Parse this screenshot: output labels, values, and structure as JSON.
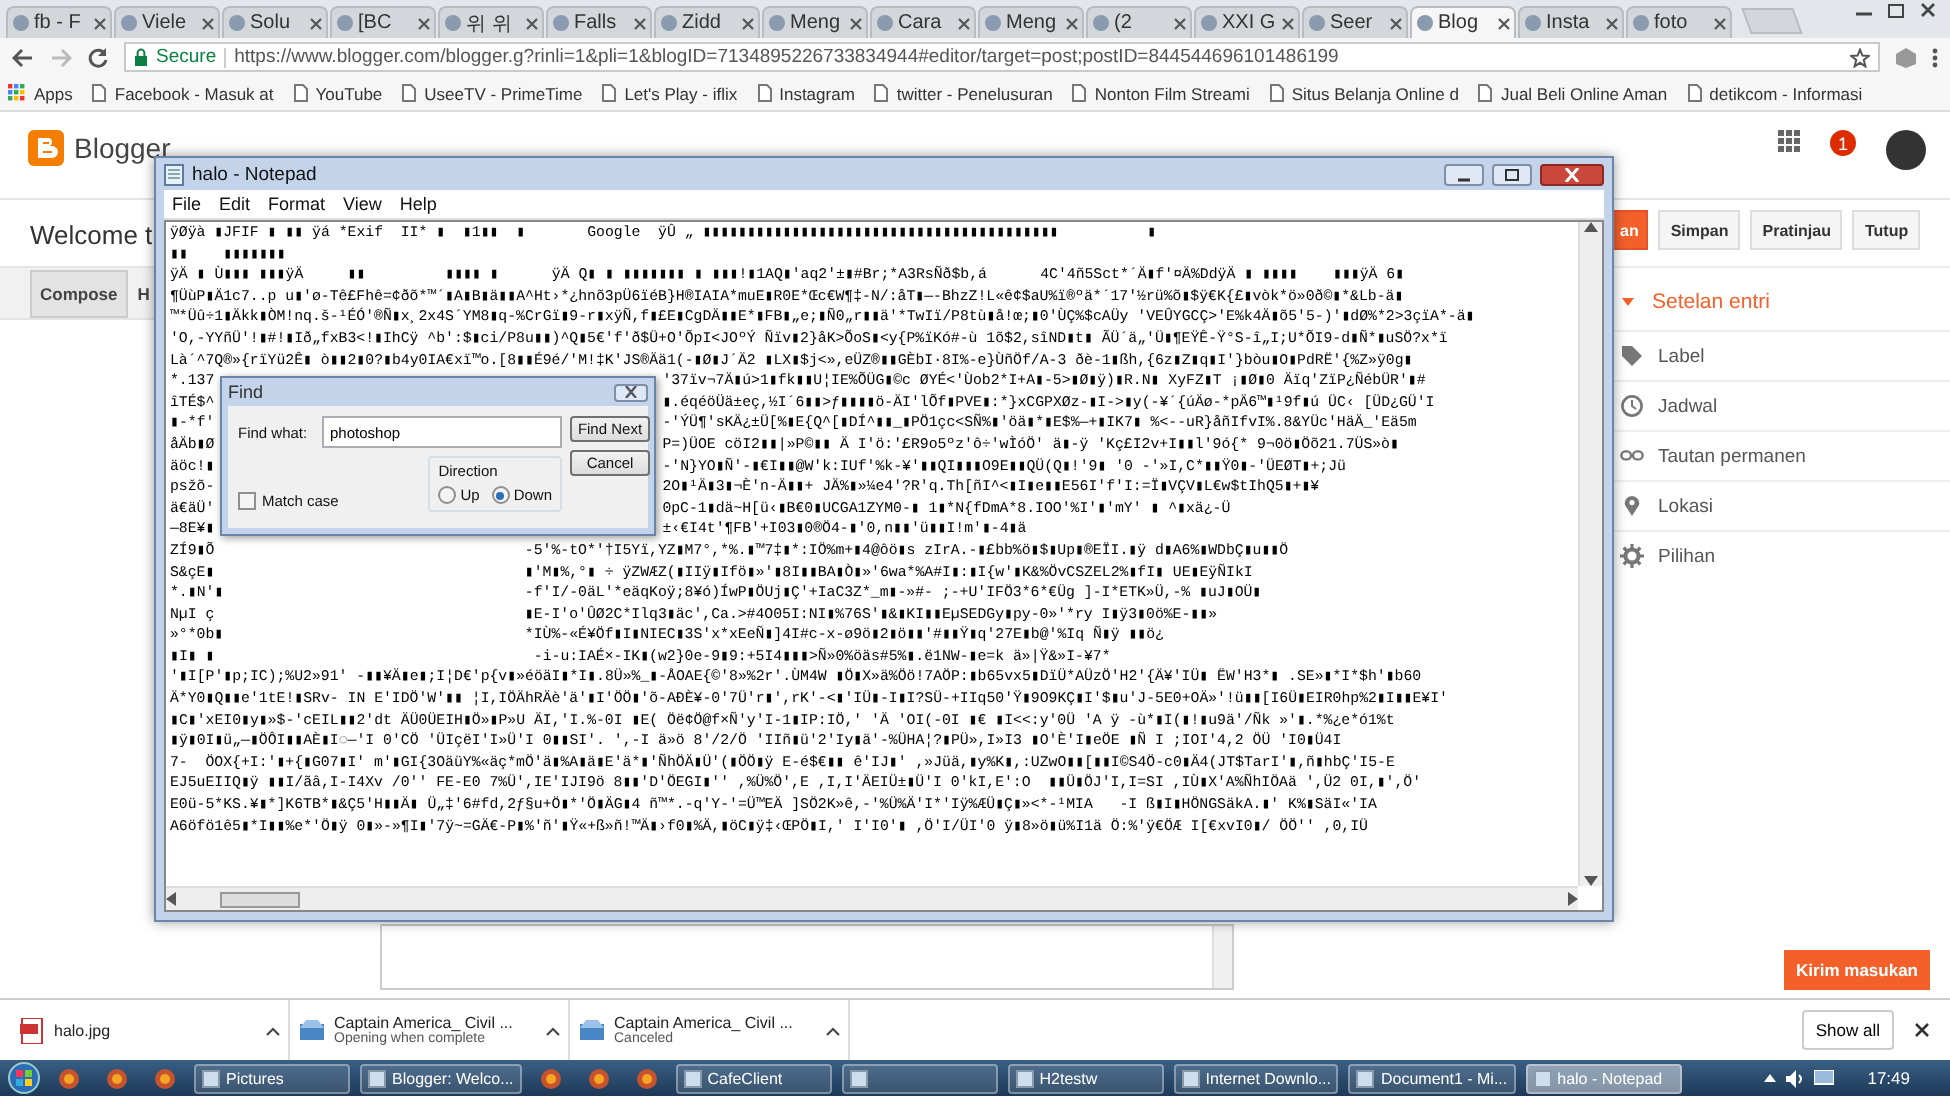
{
  "browser": {
    "tabs": [
      {
        "title": "fb - F",
        "selected": false
      },
      {
        "title": "Viele",
        "selected": false
      },
      {
        "title": "Solu",
        "selected": false
      },
      {
        "title": "[BC",
        "selected": false
      },
      {
        "title": "위 위",
        "selected": false
      },
      {
        "title": "Falls",
        "selected": false
      },
      {
        "title": "Zidd",
        "selected": false
      },
      {
        "title": "Meng",
        "selected": false
      },
      {
        "title": "Cara",
        "selected": false
      },
      {
        "title": "Meng",
        "selected": false
      },
      {
        "title": "(2",
        "selected": false
      },
      {
        "title": "XXI G",
        "selected": false
      },
      {
        "title": "Seer",
        "selected": false
      },
      {
        "title": "Blog",
        "selected": true
      },
      {
        "title": "Insta",
        "selected": false
      },
      {
        "title": "foto",
        "selected": false
      }
    ],
    "address": {
      "secure_label": "Secure",
      "url": "https://www.blogger.com/blogger.g?rinli=1&pli=1&blogID=7134895226733834944#editor/target=post;postID=844544696101486199"
    },
    "bookmarks": [
      "Apps",
      "Facebook - Masuk at",
      "YouTube",
      "UseeTV - PrimeTime",
      "Let's Play - iflix",
      "Instagram",
      "twitter - Penelusuran",
      "Nonton Film Streami",
      "Situs Belanja Online d",
      "Jual Beli Online Aman",
      "detikcom - Informasi"
    ]
  },
  "blogger": {
    "logo": "Blogger",
    "notification_count": "1",
    "welcome": "Welcome t",
    "editor_tabs": [
      {
        "label": "Compose",
        "selected": true
      },
      {
        "label": "H",
        "selected": false
      }
    ],
    "buttons": [
      {
        "label": "an",
        "kind": "primary"
      },
      {
        "label": "Simpan",
        "kind": "plain"
      },
      {
        "label": "Pratinjau",
        "kind": "plain"
      },
      {
        "label": "Tutup",
        "kind": "plain"
      }
    ],
    "settings_title": "Setelan entri",
    "settings": [
      {
        "label": "Label",
        "kind": "tag"
      },
      {
        "label": "Jadwal",
        "kind": "clock"
      },
      {
        "label": "Tautan permanen",
        "kind": "link"
      },
      {
        "label": "Lokasi",
        "kind": "pin"
      },
      {
        "label": "Pilihan",
        "kind": "gear"
      }
    ],
    "feedback": "Kirim masukan"
  },
  "notepad": {
    "title": "halo - Notepad",
    "menu": [
      "File",
      "Edit",
      "Format",
      "View",
      "Help"
    ],
    "lines": [
      "ÿØÿà ▮JFIF ▮ ▮▮ ÿá *Exif  II* ▮  ▮1▮▮  ▮       Google  ÿÛ „ ▮▮▮▮▮▮▮▮▮▮▮▮▮▮▮▮▮▮▮▮▮▮▮▮▮▮▮▮▮▮▮▮▮▮▮▮▮▮▮▮          ▮",
      "▮▮    ▮▮▮▮▮▮▮",
      "ÿÄ ▮ Ù▮▮▮ ▮▮▮ÿÄ     ▮▮         ▮▮▮▮ ▮      ÿÄ Q▮ ▮ ▮▮▮▮▮▮▮ ▮ ▮▮▮!▮1AQ▮'aq2'±▮#Br;*A3RsÑð$b,á      4C'4ñ5Sct*´Ä▮f'¤Ä%DdÿÄ ▮ ▮▮▮▮    ▮▮▮ÿÄ 6▮",
      "¶ÜùP▮Ä1c7..p u▮'ø-Tê£Fhê=¢ðõ*™´▮A▮B▮ä▮▮A^Ht›*¿hnõ3pÜ6ïéB}H®IAIA*muE▮R0E*Œc€W¶‡-N/:åT▮—-BhzZ!L«ê¢$aU%ï®ºä*´17'½rü%õ▮$ÿ€K{£▮vòk*ö»0ð©▮*&Lb-ä▮",
      "™*Üû÷1▮Äkk▮ÒM!nq.š-¹ÉÓ'®Ñ▮x¸2x4S´YM8▮q-%CrGï▮9-r▮xÿÑ,f▮£E▮CgDÄ▮▮E*▮FB▮„e;▮Ñ0„r▮▮ä'*TwIï/P8tù▮å!œ;▮0'ÙÇ%$cAÜy 'VEÛYGCÇ>'E%k4Ä▮õ5'5-)'▮dØ%*2>3çïA*-ä▮",
      "'O,-YYñÜ'!▮#!▮Ið„fxB3<!▮IhCÿ ^b':$▮ci/P8u▮▮)^Q▮5€'f'ð$Ü+O'ÕpI<JOºÝ Ñïv▮2}åK>ÕoS▮<y{P%ïKó#-ù 1õ$2,sîND▮t▮ ÃÜ´ä„'Ü▮¶EŸÊ-Ÿ°S-î„I;U*ÕI9-d▮Ñ*▮uSÖ?x*ï",
      "Là´^7Q®»{rïYü2Ê▮ ò▮▮2▮0?▮b4y0IA€xï™o.[8▮▮É9é/'M!‡K'JS®Ää1(-▮Ø▮J´Ä2 ▮LX▮$j<»,eÜZ®▮▮GÈbI·8I%-e}ÙñÖf/A-3 ðè-1▮ßh,{6z▮Z▮q▮I'}bòu▮O▮PdRË'{%Z»ÿ0g▮",
      [
        "*.137",
        "'37ïv¬7Ä▮ú>1▮fk▮▮U¦IE%ÕÜG▮©c ØYÉ<'Ùob2*I+A▮-5>▮Ø▮ÿ)▮R.N▮ XyFZ▮T ¡▮Ø▮0 Äïq'ZïP¿ÑébÜR'▮#"
      ],
      [
        "îTÉ$^",
        "▮.éqéöÜä±eç,½I´6▮▮>ƒ▮▮▮▮ö-ÄI'lÕf▮PVE▮:*}xCGPXØz-▮I->▮y(-¥´{úÄø-*pÄ6™▮¹9f▮ú ÜC‹ [ÜD¿GÜ'I"
      ],
      [
        "▮-*f'",
        "-'ÝÜ¶'sKÄ¿±Ü[%▮E{Q^[▮DÍ^▮▮_▮PÖ1çc<SÑ%▮'öä▮*▮E$%—+▮IK7▮ %<--uR}åñIfvI%.8&YÜc'HäÄ_'Eä5m"
      ],
      [
        "åÄb▮Ø",
        "P=)ÜOE cöI2▮▮|»P©▮▮ Ä I'ö:'£R9o5ºz'ô÷'wÌóÖ' ä▮-ÿ 'Kç£I2v+I▮▮l'9ó{* 9¬0ö▮Öõ21.7ÜS»ò▮"
      ],
      [
        "äöc!▮",
        "-'N}YO▮Ñ'-▮€I▮▮@W'k:IUf'%k-¥'▮▮QI▮▮▮O9E▮▮QÜ(Q▮!'9▮ '0 -'»I,C*▮▮Ÿ0▮-'ÜEØT▮+;Jü"
      ],
      [
        "psžõ-",
        "2O▮¹Ä▮3▮¬È'n-Ä▮▮+ JÄ%▮»¼e4'?R'q.Th[ñI^<▮I▮e▮▮E56I'f'I:=Ï▮VÇV▮L€w$tIhQ5▮+▮¥"
      ],
      [
        "ä€äÜ'",
        "0pC-1▮dä~H[ü‹▮B€0▮UCGA1ZYM0-▮ 1▮*N{fDmA*8.IOO'%I'▮'mY' ▮ ^▮xä¿-Ü"
      ],
      [
        "—8E¥▮",
        "±‹€I4t'¶FB'+I03▮0®Ö4-▮'0,n▮▮'ü▮▮I!m'▮-4▮ä"
      ],
      "ZÍ9▮Õ                                   -5'%-tO*'†I5Yï,YZ▮M7°,*%.▮™7‡▮*:IÖ%m+▮4@ôö▮s zIrA.-▮£bb%ö▮$▮Up▮®EÏI.▮ÿ d▮A6%▮WDbÇ▮u▮▮Ö",
      "S&çE▮                                   ▮'M▮%,°▮ ÷ ÿZWÆZ(▮IIÿ▮Ifö▮»'▮8I▮▮BA▮Ò▮»'6wa*%A#I▮:▮I{w'▮K&%ÖvCSZEL2%▮fI▮ UE▮EÿÑIkI",
      "*.▮N'▮                                  -f'I/-0äL'*eäqKoÿ;8¥ó)ÍwP▮ÖUj▮Ç'+IaC3Z*_m▮-»#- ;-+U'IFÖ3*6*€Üg ]-I*ETK»Ü,-% ▮uJ▮OÜ▮",
      "NµI ç                                   ▮E-I'o'ÛØ2C*Ilq3▮äc',Ca.>#4O05I:NI▮%76S'▮&▮KI▮▮EµSEDGy▮py-0»'*ry I▮ÿ3▮0ö%E-▮▮»",
      "»°*0b▮                                  *IÙ%-«É¥Öf▮I▮NIEC▮3S'x*xEeÑ▮]4I#c-x-ø9ö▮2▮ö▮▮'#▮▮Ÿ▮q'27E▮b@'%Iq Ñ▮ÿ ▮▮ö¿",
      "▮I▮ ▮                                    -i-u:IAÉ×-IK▮(w2}0e-9▮9:+5I4▮▮▮>Ñ»0%öäs#5%▮.ë1NW-▮e=k ä»|Ÿ&»I-¥7*",
      "'▮I[P'▮p;IC);%U2»91' -▮▮¥Ä▮e▮;I¦D€'p{v▮»éöäI▮*I▮.8Ü»%_▮-ÅOAE{©'8»%2r'.ÙM4W ▮Ö▮X»ä%Öö!7AÖP:▮b65vx5▮DïÜ*AÜzÖ'H2'{Ä¥'IÜ▮ ËW'H3*▮ .SE»▮*I*$h'▮b60",
      "Ä*Y0▮Q▮▮e'1tE!▮SRv- IN E'IDÖ'W'▮▮ ¦I,IÖÄhRÄè'ä'▮I'ÖÖ▮'õ-AÐÈ¥-0'7Ü'r▮',rK'-<▮'IÜ▮-I▮I?SÜ-+IIq50'Ÿ▮9O9KÇ▮I'$▮u'J-5E0+OÄ»'!ü▮▮[I6Ü▮EIR0hp%2▮I▮▮E¥I'",
      "▮C▮'xEI0▮y▮»$-'cEIL▮▮2'dt ÄÜ0ÜEIH▮Ö»▮P»U ÄI,'I.%-0I ▮E( Öë¢Ö@f×Ñ'y'I-1▮IP:IÖ,' 'Ä 'OI(-0I ▮€ ▮I<<:y'0Ü 'A ÿ -ù*▮I(▮!▮u9ä'/Ñk »'▮.*%¿e*ó1%t",
      "▮ÿ▮0I▮ü„—▮ÖÔI▮▮AÈ▮I◌—'I 0'CÖ 'ÜIçëI'I»Ü'I 0▮▮SI'. ',-I ä»ö 8'/2/Ö 'IIñ▮ü'2'Iy▮ä'-%ÜHA¦?▮PÜ»,I»I3 ▮O'È'I▮eÖE ▮Ñ I ;IOI'4,2 ÖÜ 'I0▮Ü4I",
      "7-  ÖOX{+I:'▮+{▮G07▮I' m'▮GI{3OäüY%«äç*mÖ'ä▮%A▮ä▮E'ä*▮'ÑhÖÄ▮Ü'(▮ÖÖ▮ÿ E-é$€▮▮ ê'IJ▮' ,»Jüä,▮y%K▮,:UZwO▮▮[▮▮I©S4Ö-c0▮Ä4(JT$TarI'▮,ñ▮hbÇ'I5-E",
      "EJ5uEIIQ▮ÿ ▮▮I/ãâ,I-I4Xv /0'' FE-E0 7%Ü',IE'IJI9ö 8▮▮'D'ÖEGI▮'' ,%Ü%Ö',E ,I,I'ÄEIÜ±▮Ü'I 0'kI,E':O  ▮▮Ü▮ÖJ'I,I=SI ,IÙ▮X'A%ÑhIÖAä ',Ü2 0I,▮',Ö'",
      "E0ü-5*KS.¥▮*]K6TB*▮&Ç5'H▮▮Ä▮ Ü„‡'6#fd,2ƒ§u+Ö▮*'Ö▮ÄG▮4 ñ™*.-q'Y-'=Ü™EÄ ]SÖ2K»ê,-'%Ü%Ä'I*'Iÿ%ÆÜ▮Ç▮»<*-¹MIA   -I ß▮I▮HÖNGSäkA.▮' K%▮SäI«'IA",
      "A6öfö1ê5▮*I▮▮%e*'Ö▮ÿ 0▮»-»¶I▮'7ÿ~=GÄ€-P▮%'ñ'▮Ÿ«+ß»ñ!™Ä▮›f0▮%Ä,▮öC▮ÿ‡‹ŒPÖ▮I,' I'I0'▮ ,Ö'I/ÜI'0 ÿ▮8»ö▮ü%I1ä Ö:%'ÿ€ÖÆ I[€xvI0▮/ ÖÖ'' ,0,IÜ"
    ]
  },
  "find": {
    "title": "Find",
    "label": "Find what:",
    "value": "photoshop",
    "buttons": [
      "Find Next",
      "Cancel"
    ],
    "match_case": {
      "label": "Match case",
      "checked": false
    },
    "direction_label": "Direction",
    "directions": [
      {
        "label": "Up",
        "selected": false
      },
      {
        "label": "Down",
        "selected": true
      }
    ]
  },
  "downloads": {
    "items": [
      {
        "name": "halo.jpg",
        "kind": "image"
      },
      {
        "name": "Captain America_ Civil ...",
        "status": "Opening when complete",
        "kind": "video"
      },
      {
        "name": "Captain America_ Civil ...",
        "status": "Canceled",
        "kind": "video"
      }
    ],
    "show_all": "Show all"
  },
  "taskbar": {
    "items": [
      {
        "kind": "pinned"
      },
      {
        "kind": "pinned"
      },
      {
        "kind": "pinned"
      },
      {
        "kind": "window",
        "label": "Pictures",
        "selected": false
      },
      {
        "kind": "window",
        "label": "Blogger: Welco...",
        "selected": false
      },
      {
        "kind": "pinned"
      },
      {
        "kind": "pinned"
      },
      {
        "kind": "pinned"
      },
      {
        "kind": "window",
        "label": "CafeClient",
        "selected": false
      },
      {
        "kind": "window",
        "selected": false
      },
      {
        "kind": "window",
        "label": "H2testw",
        "selected": false
      },
      {
        "kind": "window",
        "label": "Internet Downlo...",
        "selected": false
      },
      {
        "kind": "window",
        "label": "Document1 - Mi...",
        "selected": false
      },
      {
        "kind": "window",
        "label": "halo - Notepad",
        "selected": true
      }
    ],
    "clock": "17:49"
  }
}
